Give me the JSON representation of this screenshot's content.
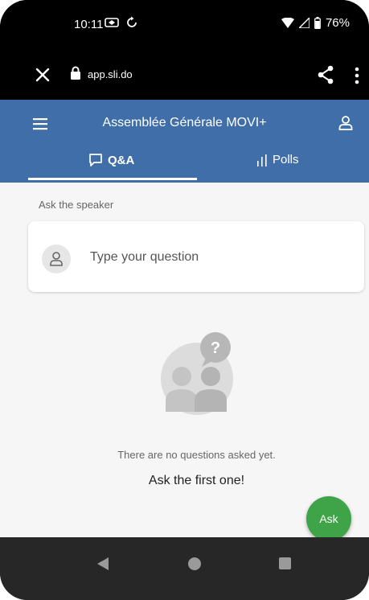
{
  "status_bar": {
    "time": "10:11",
    "battery": "76%",
    "icons": [
      "notification-icon",
      "sync-icon",
      "wifi-icon",
      "signal-icon",
      "battery-icon"
    ]
  },
  "browser": {
    "url": "app.sli.do",
    "icons": [
      "close-icon",
      "lock-icon",
      "share-icon",
      "more-vert-icon"
    ]
  },
  "header": {
    "title": "Assemblée Générale MOVI+",
    "tabs": [
      {
        "label": "Q&A",
        "icon": "chat-icon",
        "active": true
      },
      {
        "label": "Polls",
        "icon": "bar-chart-icon",
        "active": false
      }
    ]
  },
  "qa": {
    "section_label": "Ask the speaker",
    "input_placeholder": "Type your question",
    "empty_text": "There are no questions asked yet.",
    "empty_cta": "Ask the first one!",
    "ask_button": "Ask"
  },
  "colors": {
    "header": "#3f6ea8",
    "ask_button": "#3ea447",
    "background": "#f6f6f6"
  }
}
